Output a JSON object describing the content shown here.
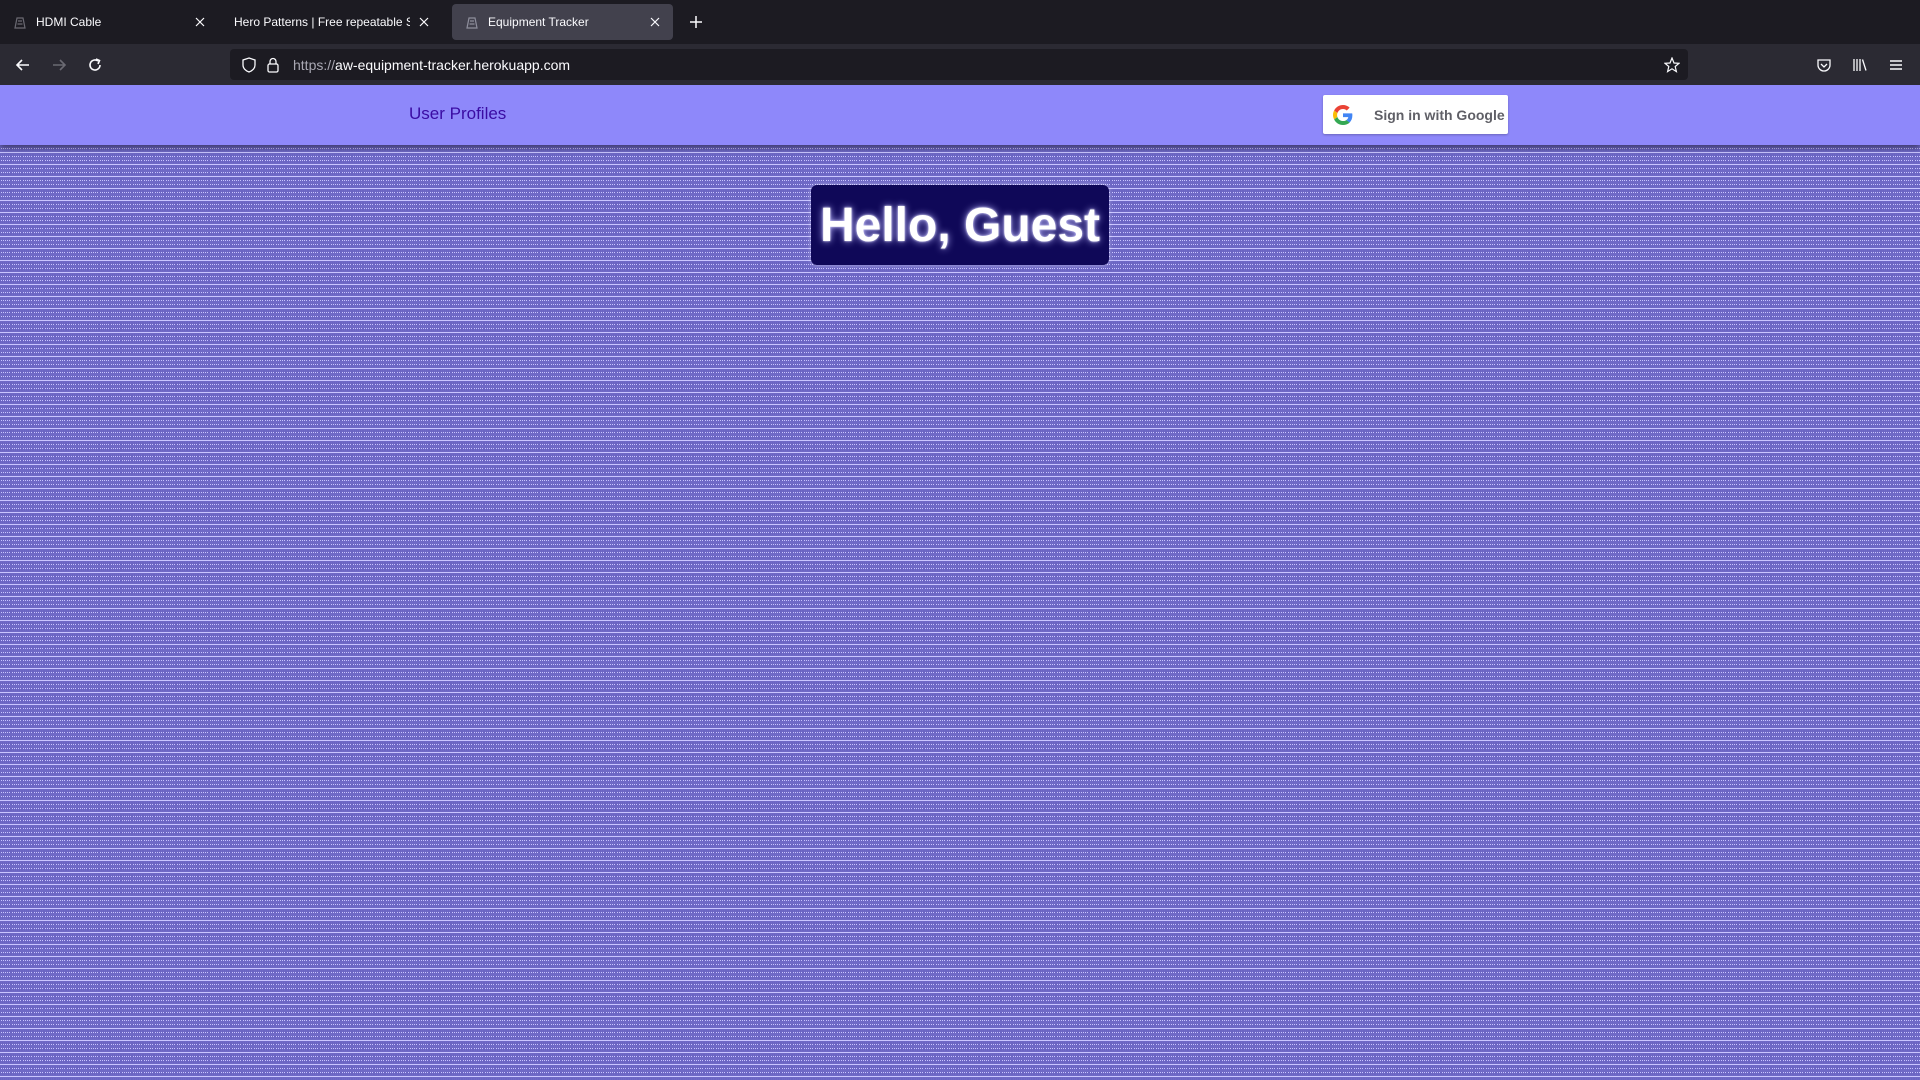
{
  "browser": {
    "tabs": [
      {
        "title": "HDMI Cable",
        "icon": "site-favicon",
        "active": false
      },
      {
        "title": "Hero Patterns | Free repeatable SVG",
        "icon": "none",
        "active": false
      },
      {
        "title": "Equipment Tracker",
        "icon": "site-favicon",
        "active": true
      }
    ],
    "url_scheme": "https://",
    "url_host": "aw-equipment-tracker.herokuapp.com"
  },
  "header": {
    "nav_link": "User Profiles",
    "signin_label": "Sign in with Google"
  },
  "main": {
    "greeting": "Hello, Guest"
  },
  "colors": {
    "header_bg": "#8e88fa",
    "nav_link": "#3a0ca3",
    "greeting_bg": "#0f0858",
    "pattern_light": "#c9c5ff",
    "pattern_dark": "#6b65c3"
  }
}
